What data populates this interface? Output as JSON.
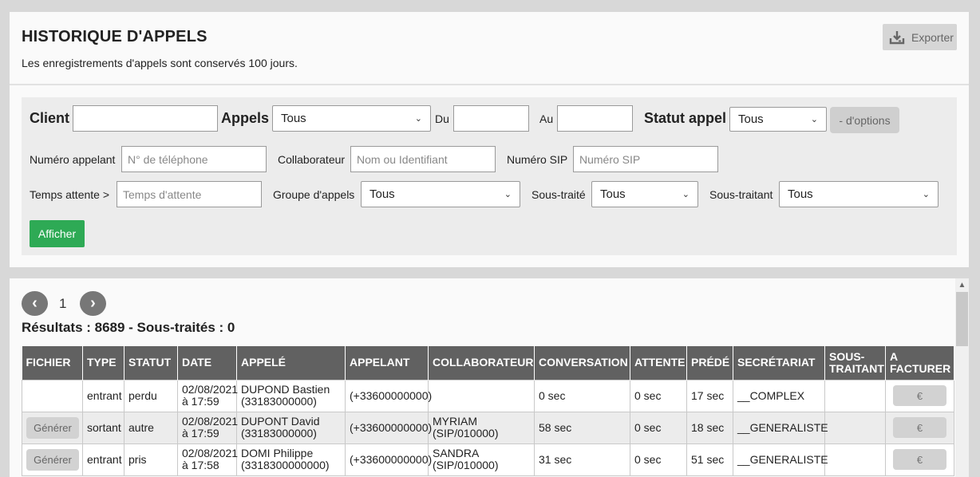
{
  "header": {
    "title": "HISTORIQUE D'APPELS",
    "subtitle": "Les enregistrements d'appels sont conservés 100 jours.",
    "export_label": "Exporter"
  },
  "filters": {
    "client_label": "Client",
    "client_value": "",
    "appels_label": "Appels",
    "appels_value": "Tous",
    "du_label": "Du",
    "du_value": "",
    "au_label": "Au",
    "au_value": "",
    "statut_label": "Statut appel",
    "statut_value": "Tous",
    "options_label": "- d'options",
    "numero_appelant_label": "Numéro appelant",
    "numero_appelant_placeholder": "N° de téléphone",
    "collaborateur_label": "Collaborateur",
    "collaborateur_placeholder": "Nom ou Identifiant",
    "numero_sip_label": "Numéro SIP",
    "numero_sip_placeholder": "Numéro SIP",
    "temps_attente_label": "Temps attente >",
    "temps_attente_placeholder": "Temps d'attente",
    "groupe_label": "Groupe d'appels",
    "groupe_value": "Tous",
    "sous_traite_label": "Sous-traité",
    "sous_traite_value": "Tous",
    "sous_traitant_label": "Sous-traitant",
    "sous_traitant_value": "Tous",
    "afficher_label": "Afficher"
  },
  "pagination": {
    "prev": "‹",
    "page": "1",
    "next": "›"
  },
  "results_text": "Résultats : 8689 - Sous-traités : 0",
  "table": {
    "headers": [
      "FICHIER",
      "TYPE",
      "STATUT",
      "DATE",
      "APPELÉ",
      "APPELANT",
      "COLLABORATEUR",
      "CONVERSATION",
      "ATTENTE",
      "PRÉDÉ",
      "SECRÉTARIAT",
      "SOUS-\nTRAITANT",
      "A\nFACTURER"
    ],
    "rows": [
      {
        "fichier": "",
        "type": "entrant",
        "statut": "perdu",
        "date1": "02/08/2021",
        "date2": "à 17:59",
        "appele1": "DUPOND Bastien",
        "appele2": "(33183000000)",
        "appelant": "(+33600000000)",
        "collab1": "",
        "collab2": "",
        "conversation": "0 sec",
        "attente": "0 sec",
        "prede": "17 sec",
        "secretariat": "__COMPLEX",
        "sous_traitant": "",
        "facturer": "€"
      },
      {
        "fichier": "Générer",
        "type": "sortant",
        "statut": "autre",
        "date1": "02/08/2021",
        "date2": "à 17:59",
        "appele1": "DUPONT David",
        "appele2": "(33183000000)",
        "appelant": "(+33600000000)",
        "collab1": "MYRIAM",
        "collab2": "(SIP/010000)",
        "conversation": "58 sec",
        "attente": "0 sec",
        "prede": "18 sec",
        "secretariat": "__GENERALISTE",
        "sous_traitant": "",
        "facturer": "€"
      },
      {
        "fichier": "Générer",
        "type": "entrant",
        "statut": "pris",
        "date1": "02/08/2021",
        "date2": "à 17:58",
        "appele1": "DOMI Philippe",
        "appele2": "(3318300000000)",
        "appelant": "(+33600000000)",
        "collab1": "SANDRA",
        "collab2": "(SIP/010000)",
        "conversation": "31 sec",
        "attente": "0 sec",
        "prede": "51 sec",
        "secretariat": "__GENERALISTE",
        "sous_traitant": "",
        "facturer": "€"
      }
    ]
  }
}
